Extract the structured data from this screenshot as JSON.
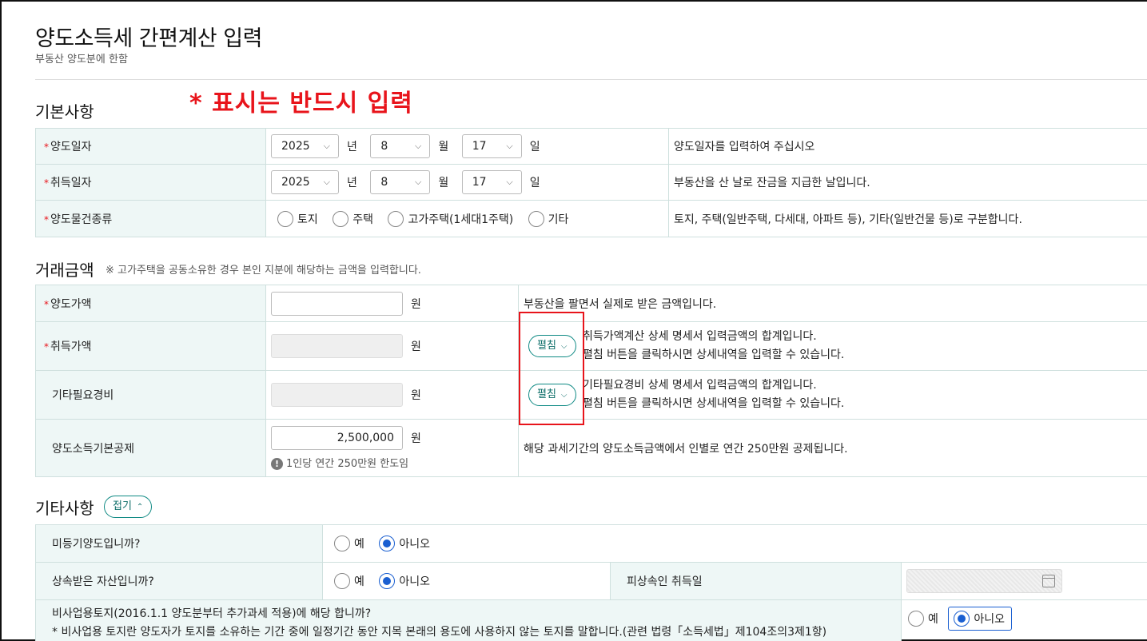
{
  "page": {
    "title": "양도소득세 간편계산 입력",
    "subtitle": "부동산 양도분에 한함",
    "required_note": "* 표시는 반드시 입력"
  },
  "basic": {
    "section_title": "기본사항",
    "rows": [
      {
        "label": "양도일자",
        "year": "2025",
        "month": "8",
        "day": "17",
        "desc": "양도일자를 입력하여 주십시오"
      },
      {
        "label": "취득일자",
        "year": "2025",
        "month": "8",
        "day": "17",
        "desc": "부동산을 산 날로 잔금을 지급한 날입니다."
      }
    ],
    "unit_year": "년",
    "unit_month": "월",
    "unit_day": "일",
    "type_row": {
      "label": "양도물건종류",
      "options": [
        "토지",
        "주택",
        "고가주택(1세대1주택)",
        "기타"
      ],
      "desc": "토지, 주택(일반주택, 다세대, 아파트 등), 기타(일반건물 등)로 구분합니다."
    }
  },
  "amount": {
    "section_title": "거래금액",
    "section_note": "※ 고가주택을 공동소유한 경우 본인 지분에 해당하는 금액을 입력합니다.",
    "unit": "원",
    "sale": {
      "label": "양도가액",
      "value": "",
      "desc": "부동산을 팔면서 실제로 받은 금액입니다."
    },
    "acquisition": {
      "label": "취득가액",
      "button": "펼침",
      "desc1": "취득가액계산 상세 명세서 입력금액의 합계입니다.",
      "desc2": "펼침 버튼을 클릭하시면 상세내역을 입력할 수 있습니다."
    },
    "expense": {
      "label": "기타필요경비",
      "button": "펼침",
      "desc1": "기타필요경비 상세 명세서 입력금액의 합계입니다.",
      "desc2": "펼침 버튼을 클릭하시면 상세내역을 입력할 수 있습니다."
    },
    "deduction": {
      "label": "양도소득기본공제",
      "value": "2,500,000",
      "hint": "1인당 연간 250만원 한도임",
      "desc": "해당 과세기간의 양도소득금액에서 인별로 연간 250만원 공제됩니다."
    }
  },
  "etc": {
    "section_title": "기타사항",
    "toggle_label": "접기",
    "yes": "예",
    "no": "아니오",
    "q1": "미등기양도입니까?",
    "q2": "상속받은 자산입니까?",
    "q2_side_label": "피상속인 취득일",
    "q3_line1": "비사업용토지(2016.1.1 양도분부터 추가과세 적용)에 해당 합니까?",
    "q3_line2": "* 비사업용 토지란 양도자가 토지를 소유하는 기간 중에 일정기간 동안 지목 본래의 용도에 사용하지 않는 토지를 말합니다.(관련 법령「소득세법」제104조의3제1항)"
  }
}
